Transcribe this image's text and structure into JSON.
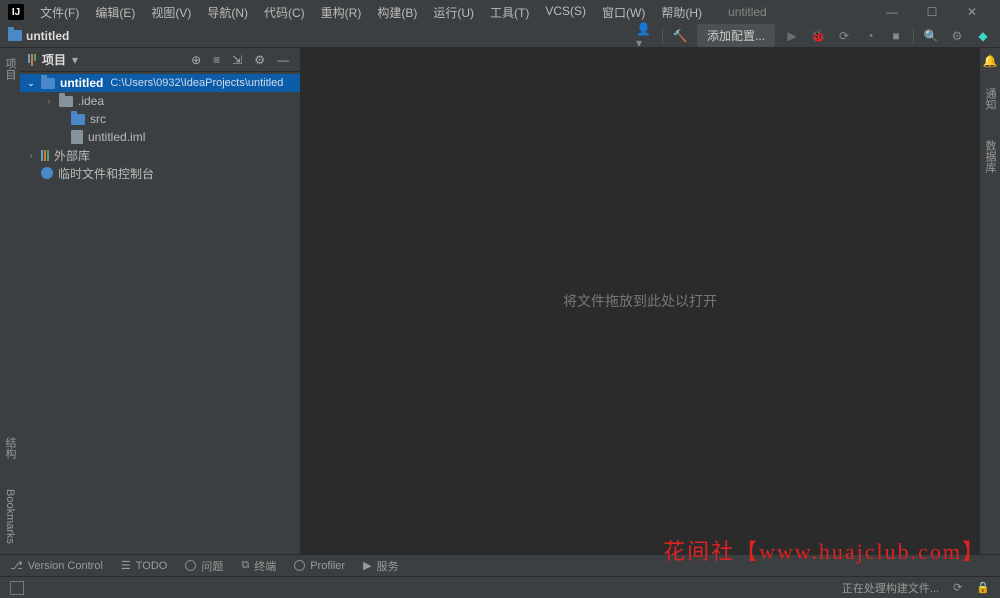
{
  "window": {
    "title": "untitled"
  },
  "menu": {
    "file": "文件(F)",
    "edit": "编辑(E)",
    "view": "视图(V)",
    "navigate": "导航(N)",
    "code": "代码(C)",
    "refactor": "重构(R)",
    "build": "构建(B)",
    "run": "运行(U)",
    "tools": "工具(T)",
    "vcs": "VCS(S)",
    "window": "窗口(W)",
    "help": "帮助(H)"
  },
  "breadcrumb": {
    "project": "untitled"
  },
  "toolbar": {
    "add_config": "添加配置..."
  },
  "leftbar": {
    "project": "项目",
    "bookmarks": "Bookmarks",
    "structure": "结构"
  },
  "rightbar": {
    "notifications": "通知",
    "database": "数据库"
  },
  "project_panel": {
    "title": "项目"
  },
  "tree": {
    "root": {
      "name": "untitled",
      "path": "C:\\Users\\0932\\IdeaProjects\\untitled"
    },
    "idea": ".idea",
    "src": "src",
    "iml": "untitled.iml",
    "external_libs": "外部库",
    "scratches": "临时文件和控制台"
  },
  "editor": {
    "placeholder": "将文件拖放到此处以打开"
  },
  "bottom": {
    "version_control": "Version Control",
    "todo": "TODO",
    "problems": "问题",
    "terminal": "终端",
    "profiler": "Profiler",
    "services": "服务"
  },
  "status": {
    "build_msg": "正在处理构建文件..."
  },
  "watermark": "花间社【www.huajclub.com】"
}
